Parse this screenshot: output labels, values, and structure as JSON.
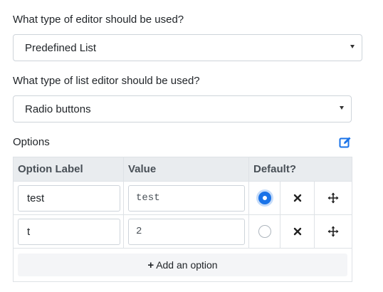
{
  "editor_type": {
    "question": "What type of editor should be used?",
    "selected": "Predefined List"
  },
  "list_editor_type": {
    "question": "What type of list editor should be used?",
    "selected": "Radio buttons"
  },
  "options": {
    "heading": "Options",
    "edit_icon": "edit-square-icon",
    "columns": [
      "Option Label",
      "Value",
      "Default?"
    ],
    "rows": [
      {
        "label": "test",
        "value": "test",
        "default": true
      },
      {
        "label": "t",
        "value": "2",
        "default": false
      }
    ],
    "add_label": "Add an option"
  },
  "colors": {
    "accent": "#1a73e8",
    "header_bg": "#e9ecef",
    "border": "#dee2e6"
  }
}
